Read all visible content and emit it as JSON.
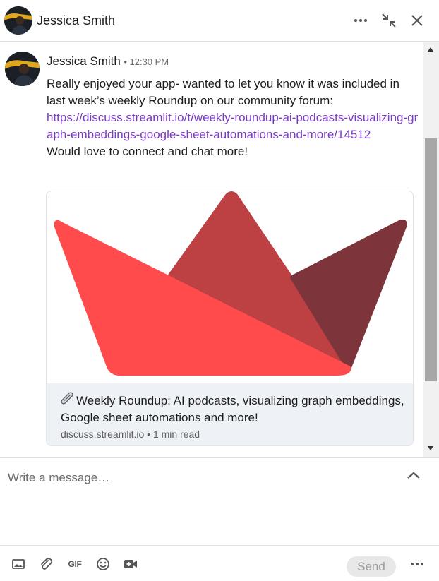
{
  "header": {
    "name": "Jessica Smith",
    "icons": [
      "more-icon",
      "minimize-icon",
      "close-icon"
    ]
  },
  "message": {
    "sender": "Jessica Smith",
    "time": "• 12:30 PM",
    "text1": "Really enjoyed your app- wanted to let you know it was included in last week’s weekly Roundup on our community forum:",
    "link": "https://discuss.streamlit.io/t/weekly-roundup-ai-podcasts-visualizing-graph-embeddings-google-sheet-automations-and-more/14512",
    "text2": "Would love to connect and chat more!"
  },
  "preview": {
    "title": "Weekly Roundup: AI podcasts, visualizing graph embeddings, Google sheet automations and more!",
    "domain": "discuss.streamlit.io",
    "read_time": "• 1 min read",
    "logo_colors": [
      "#ff4b4b",
      "#bd4043",
      "#7d353b"
    ]
  },
  "composer": {
    "placeholder": "Write a message…"
  },
  "toolbar": {
    "gif_label": "GIF",
    "send_label": "Send",
    "icons": [
      "image-icon",
      "attachment-icon",
      "gif-icon",
      "emoji-icon",
      "video-meeting-icon",
      "more-icon"
    ]
  },
  "colors": {
    "link": "#7a3bc4",
    "preview_footer": "#eef2f6"
  }
}
